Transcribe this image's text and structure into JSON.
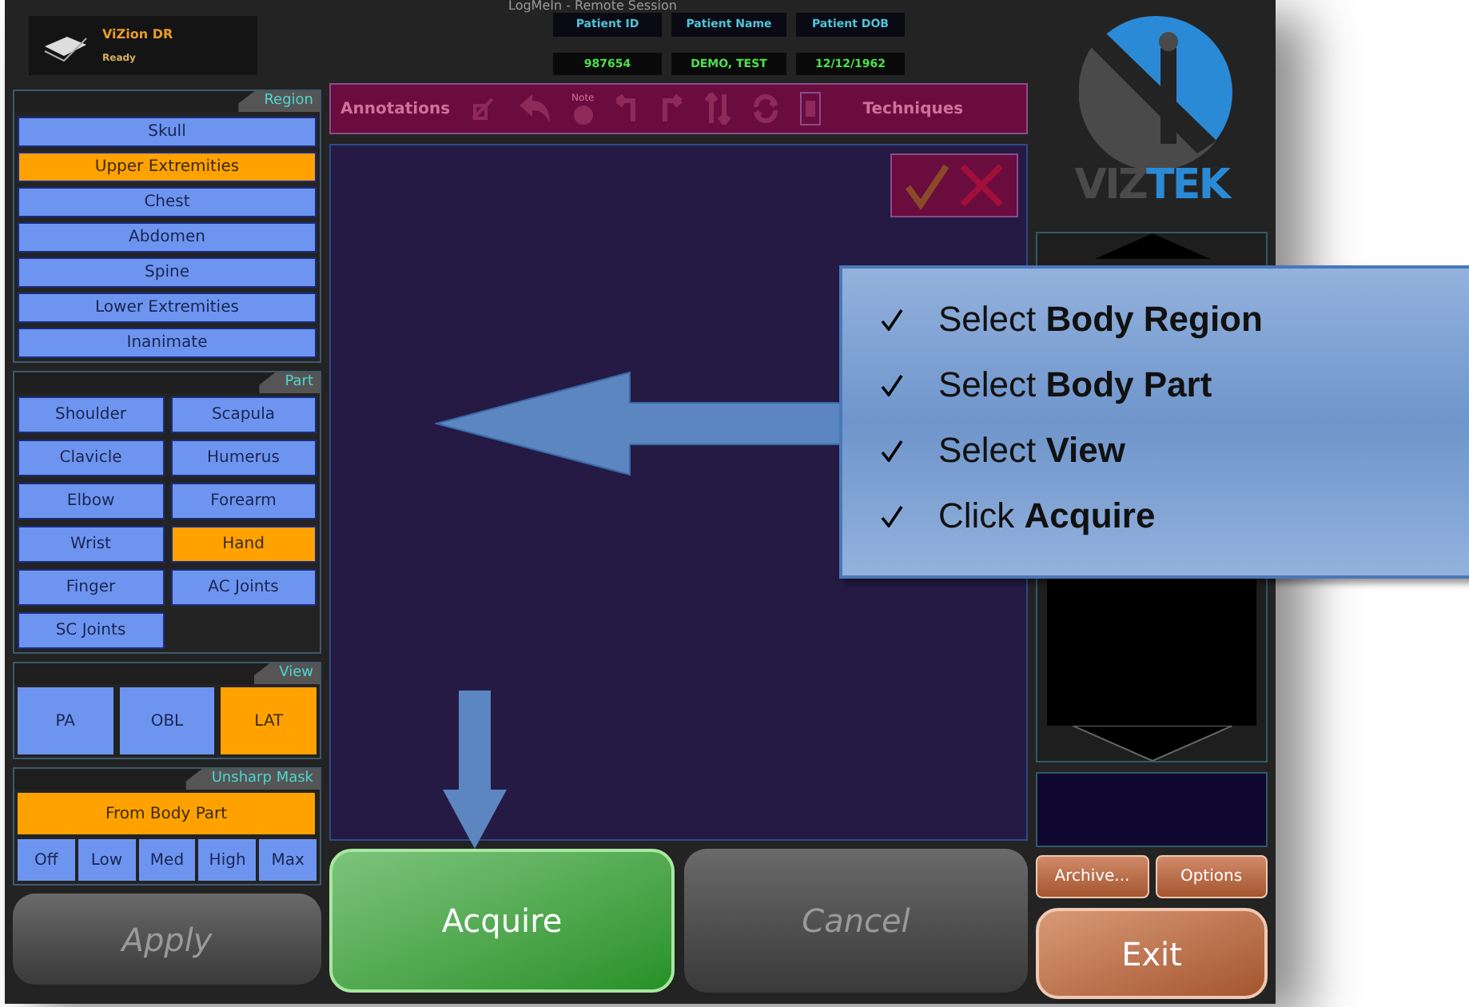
{
  "session_title": "LogMeIn - Remote Session",
  "device": {
    "name": "ViZion DR",
    "status": "Ready"
  },
  "patient": [
    {
      "label": "Patient ID",
      "value": "987654"
    },
    {
      "label": "Patient Name",
      "value": "DEMO, TEST"
    },
    {
      "label": "Patient DOB",
      "value": "12/12/1962"
    }
  ],
  "region": {
    "title": "Region",
    "items": [
      {
        "label": "Skull",
        "selected": false
      },
      {
        "label": "Upper Extremities",
        "selected": true
      },
      {
        "label": "Chest",
        "selected": false
      },
      {
        "label": "Abdomen",
        "selected": false
      },
      {
        "label": "Spine",
        "selected": false
      },
      {
        "label": "Lower Extremities",
        "selected": false
      },
      {
        "label": "Inanimate",
        "selected": false
      }
    ]
  },
  "part": {
    "title": "Part",
    "items": [
      {
        "label": "Shoulder",
        "selected": false
      },
      {
        "label": "Scapula",
        "selected": false
      },
      {
        "label": "Clavicle",
        "selected": false
      },
      {
        "label": "Humerus",
        "selected": false
      },
      {
        "label": "Elbow",
        "selected": false
      },
      {
        "label": "Forearm",
        "selected": false
      },
      {
        "label": "Wrist",
        "selected": false
      },
      {
        "label": "Hand",
        "selected": true
      },
      {
        "label": "Finger",
        "selected": false
      },
      {
        "label": "AC Joints",
        "selected": false
      },
      {
        "label": "SC Joints",
        "selected": false
      }
    ]
  },
  "view": {
    "title": "View",
    "items": [
      {
        "label": "PA",
        "selected": false
      },
      {
        "label": "OBL",
        "selected": false
      },
      {
        "label": "LAT",
        "selected": true
      }
    ]
  },
  "unsharp_mask": {
    "title": "Unsharp Mask",
    "source": {
      "label": "From Body Part",
      "selected": true
    },
    "levels": [
      {
        "label": "Off",
        "selected": false
      },
      {
        "label": "Low",
        "selected": false
      },
      {
        "label": "Med",
        "selected": false
      },
      {
        "label": "High",
        "selected": false
      },
      {
        "label": "Max",
        "selected": false
      }
    ]
  },
  "toolbar": {
    "annotations": "Annotations",
    "note": "Note",
    "techniques": "Techniques"
  },
  "logo": {
    "part_1": "VIZ",
    "part_2": "TEK"
  },
  "buttons": {
    "apply": {
      "label": "Apply",
      "disabled": true
    },
    "acquire": {
      "label": "Acquire",
      "disabled": false
    },
    "cancel": {
      "label": "Cancel",
      "disabled": true
    },
    "archive": {
      "label": "Archive..."
    },
    "options": {
      "label": "Options"
    },
    "exit": {
      "label": "Exit"
    }
  },
  "callout": {
    "steps": [
      {
        "text": "Select **Body Region**"
      },
      {
        "text": "Select **Body Part**"
      },
      {
        "text": "Select **View**"
      },
      {
        "text": "Click **Acquire**"
      }
    ]
  }
}
